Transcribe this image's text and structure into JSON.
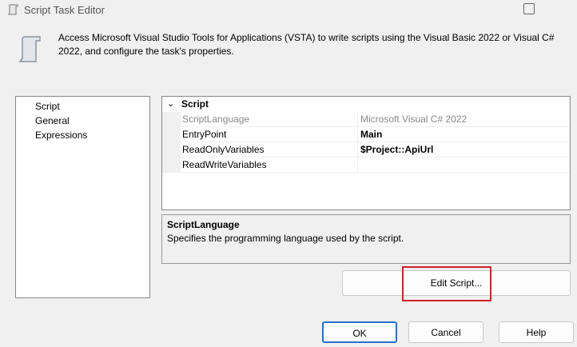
{
  "window": {
    "title": "Script Task Editor"
  },
  "header": {
    "description": "Access Microsoft Visual Studio Tools for Applications (VSTA) to write scripts using the Visual Basic 2022 or Visual C# 2022, and configure the task's properties."
  },
  "nav": {
    "items": [
      {
        "label": "Script"
      },
      {
        "label": "General"
      },
      {
        "label": "Expressions"
      }
    ]
  },
  "grid": {
    "category": "Script",
    "rows": [
      {
        "name": "ScriptLanguage",
        "value": "Microsoft Visual C# 2022"
      },
      {
        "name": "EntryPoint",
        "value": "Main"
      },
      {
        "name": "ReadOnlyVariables",
        "value": "$Project::ApiUrl"
      },
      {
        "name": "ReadWriteVariables",
        "value": ""
      }
    ]
  },
  "help": {
    "title": "ScriptLanguage",
    "text": "Specifies the programming language used by the script."
  },
  "buttons": {
    "edit": "Edit Script...",
    "ok": "OK",
    "cancel": "Cancel",
    "help": "Help"
  },
  "colors": {
    "highlight": "#d0202a",
    "accent": "#2a6fc9"
  }
}
